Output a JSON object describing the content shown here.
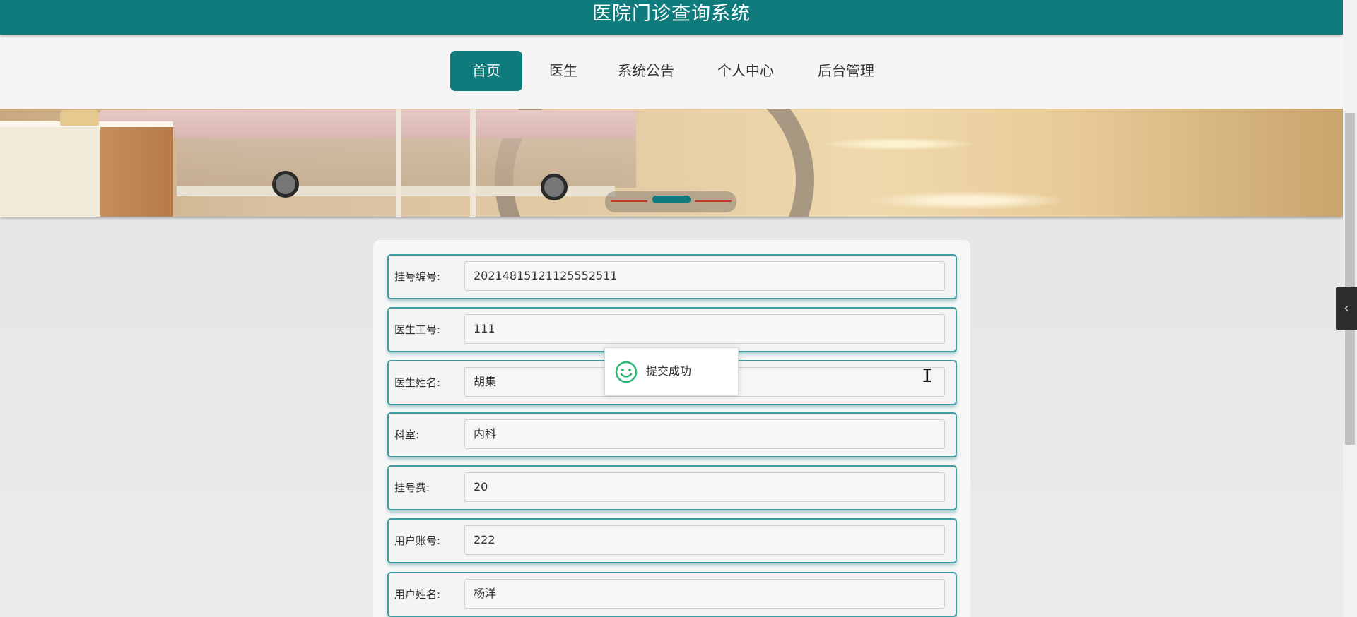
{
  "app": {
    "title": "医院门诊查询系统"
  },
  "nav": {
    "items": [
      {
        "label": "首页",
        "active": true
      },
      {
        "label": "医生",
        "active": false
      },
      {
        "label": "系统公告",
        "active": false
      },
      {
        "label": "个人中心",
        "active": false
      },
      {
        "label": "后台管理",
        "active": false
      }
    ]
  },
  "form": {
    "fields": [
      {
        "label": "挂号编号:",
        "value": "2021481512112555​2511"
      },
      {
        "label": "医生工号:",
        "value": "111"
      },
      {
        "label": "医生姓名:",
        "value": "胡集"
      },
      {
        "label": "科室:",
        "value": "内科"
      },
      {
        "label": "挂号费:",
        "value": "20"
      },
      {
        "label": "用户账号:",
        "value": "222"
      },
      {
        "label": "用户姓名:",
        "value": "杨洋"
      }
    ]
  },
  "toast": {
    "message": "提交成功",
    "icon": "smiley-icon"
  },
  "side_toggle": {
    "icon": "chevron-left-icon",
    "glyph": "‹"
  },
  "colors": {
    "primary": "#0f7b7d",
    "row_border": "#3c9ea2",
    "toast_icon": "#2bb673"
  }
}
